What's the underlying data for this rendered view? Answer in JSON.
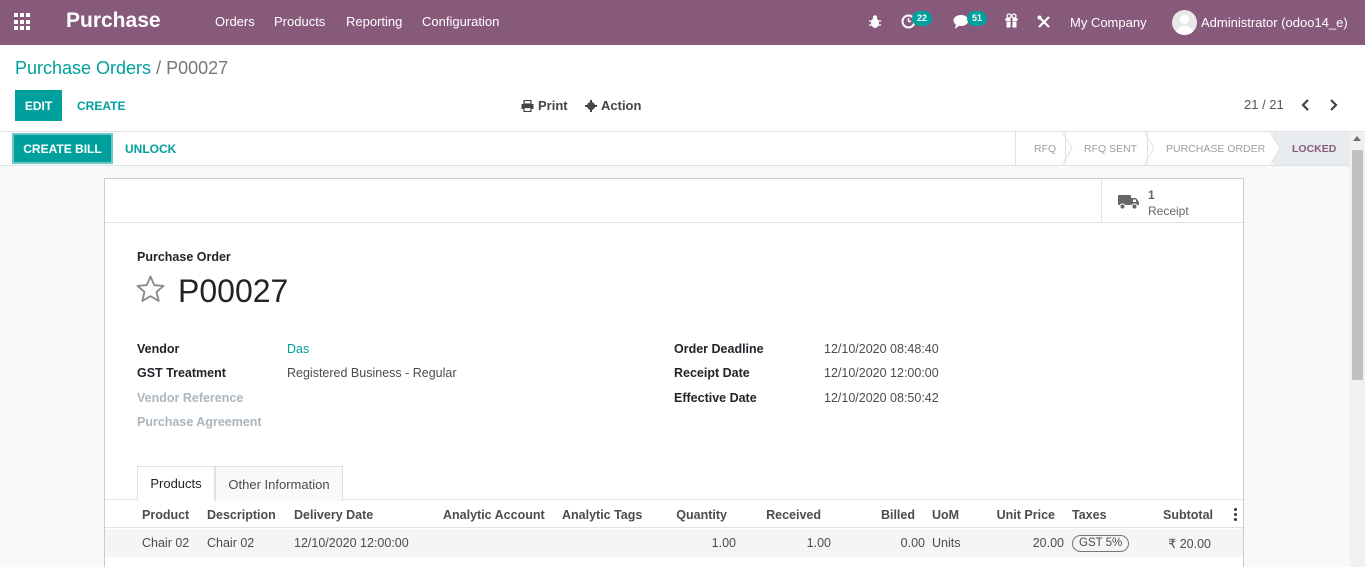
{
  "navbar": {
    "app_name": "Purchase",
    "menu": [
      "Orders",
      "Products",
      "Reporting",
      "Configuration"
    ],
    "activity_count": "22",
    "message_count": "51",
    "company": "My Company",
    "user": "Administrator (odoo14_e)"
  },
  "breadcrumb": {
    "parent": "Purchase Orders",
    "separator": "/",
    "current": "P00027"
  },
  "control": {
    "edit_label": "EDIT",
    "create_label": "CREATE",
    "print_label": "Print",
    "action_label": "Action",
    "pager": "21 / 21"
  },
  "statusbar": {
    "create_bill_label": "CREATE BILL",
    "unlock_label": "UNLOCK",
    "stages": [
      "RFQ",
      "RFQ SENT",
      "PURCHASE ORDER",
      "LOCKED"
    ],
    "active_stage": "LOCKED"
  },
  "smart_button": {
    "value": "1",
    "label": "Receipt",
    "icon": "truck-icon"
  },
  "document": {
    "label": "Purchase Order",
    "name": "P00027"
  },
  "fields_left": [
    {
      "label": "Vendor",
      "value": "Das"
    },
    {
      "label": "GST Treatment",
      "value": "Registered Business - Regular"
    },
    {
      "label": "Vendor Reference",
      "value": ""
    },
    {
      "label": "Purchase Agreement",
      "value": ""
    }
  ],
  "fields_right": [
    {
      "label": "Order Deadline",
      "value": "12/10/2020 08:48:40"
    },
    {
      "label": "Receipt Date",
      "value": "12/10/2020 12:00:00"
    },
    {
      "label": "Effective Date",
      "value": "12/10/2020 08:50:42"
    }
  ],
  "tabs": [
    "Products",
    "Other Information"
  ],
  "table": {
    "headers": [
      "Product",
      "Description",
      "Delivery Date",
      "Analytic Account",
      "Analytic Tags",
      "Quantity",
      "Received",
      "Billed",
      "UoM",
      "Unit Price",
      "Taxes",
      "Subtotal"
    ],
    "rows": [
      {
        "product": "Chair 02",
        "description": "Chair 02",
        "delivery_date": "12/10/2020 12:00:00",
        "analytic_account": "",
        "analytic_tags": "",
        "quantity": "1.00",
        "received": "1.00",
        "billed": "0.00",
        "uom": "Units",
        "unit_price": "20.00",
        "taxes": "GST 5%",
        "subtotal": "₹ 20.00"
      }
    ]
  },
  "colors": {
    "brand": "#875a7b",
    "accent": "#00a09d"
  }
}
